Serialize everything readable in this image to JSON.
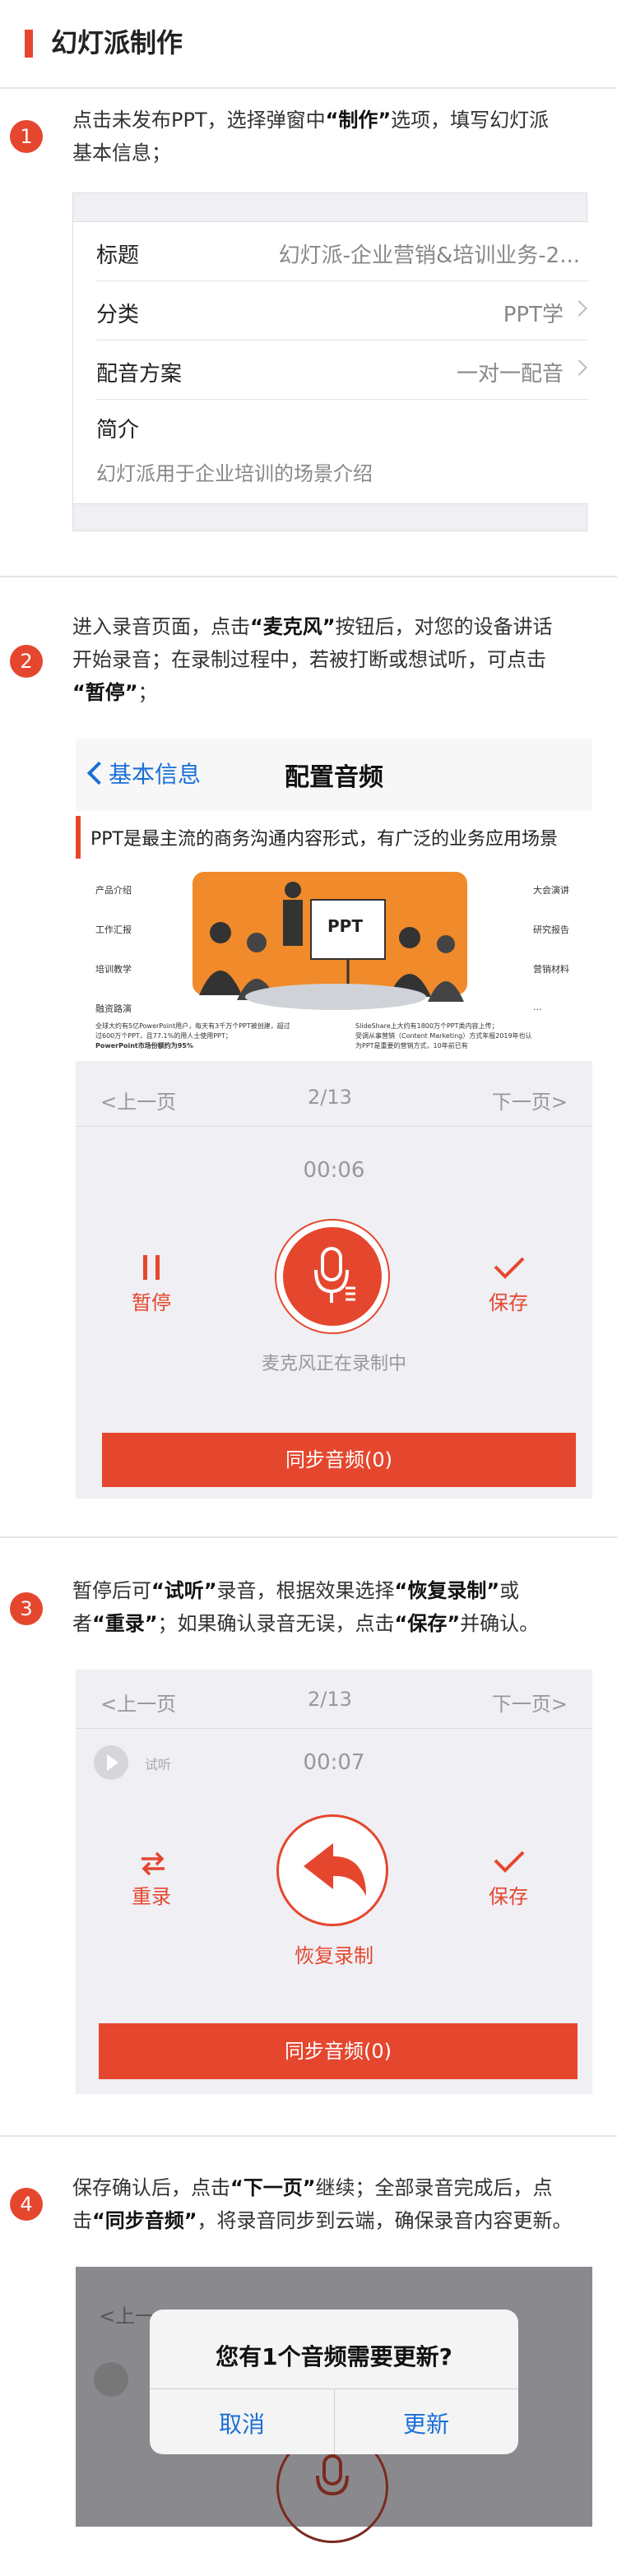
{
  "header": {
    "title": "幻灯派制作"
  },
  "steps": [
    {
      "num": "1",
      "text_a": "点击未发布PPT，选择弹窗中",
      "text_b": "“制作”",
      "text_c": "选项，填写幻灯派",
      "text_d": "基本信息；"
    },
    {
      "num": "2",
      "line1_a": "进入录音页面，点击",
      "line1_b": "“麦克风”",
      "line1_c": "按钮后，对您的设备讲话",
      "line2": "开始录音；在录制过程中，若被打断或想试听，可点击",
      "line3": "“暂停”",
      "line3_c": "；"
    },
    {
      "num": "3",
      "line1_a": "暂停后可",
      "line1_b": "“试听”",
      "line1_c": "录音，根据效果选择",
      "line1_d": "“恢复录制”",
      "line1_e": "或",
      "line2_a": "者",
      "line2_b": "“重录”",
      "line2_c": "；如果确认录音无误，点击",
      "line2_d": "“保存”",
      "line2_e": "并确认。"
    },
    {
      "num": "4",
      "line1_a": "保存确认后，点击",
      "line1_b": "“下一页”",
      "line1_c": "继续；全部录音完成后，点",
      "line2_a": "击",
      "line2_b": "“同步音频”",
      "line2_c": "，将录音同步到云端，确保录音内容更新。"
    }
  ],
  "form": {
    "rows": [
      {
        "key": "标题",
        "value": "幻灯派-企业营销&培训业务-2..."
      },
      {
        "key": "分类",
        "value": "PPT学"
      },
      {
        "key": "配音方案",
        "value": "一对一配音"
      }
    ],
    "intro_key": "简介",
    "intro_value": "幻灯派用于企业培训的场景介绍"
  },
  "screen2": {
    "back_label": "基本信息",
    "title": "配置音频",
    "slide_caption": "PPT是最主流的商务沟通内容形式，有广泛的业务应用场景",
    "slide_left_labels": [
      "产品介绍",
      "工作汇报",
      "培训教学",
      "融资路演"
    ],
    "slide_right_labels": [
      "大会演讲",
      "研究报告",
      "营销材料",
      "..."
    ],
    "slide_ppt_label": "PPT",
    "slide_note_left_1": "全球大约有5亿PowerPoint用户，每天有3千万个PPT被创建，超过",
    "slide_note_left_2": "过600万个PPT，且77.1%的用人士使用PPT；",
    "slide_note_left_3": "PowerPoint市场份额约为95%",
    "slide_note_right_1": "SlideShare上大约有1800万个PPT类内容上传；",
    "slide_note_right_2": "受调从事营销（Content Marketing）方式年报2019年也认",
    "slide_note_right_3": "为PPT是重要的营销方式，10年前已有",
    "prev": "<上一页",
    "page": "2/13",
    "next": "下一页>",
    "timer": "00:06",
    "pause_label": "暂停",
    "save_label": "保存",
    "status": "麦克风正在录制中",
    "sync_label": "同步音频(0)"
  },
  "screen3": {
    "prev": "<上一页",
    "page": "2/13",
    "next": "下一页>",
    "listen_label": "试听",
    "timer": "00:07",
    "rerecord_label": "重录",
    "save_label": "保存",
    "resume_label": "恢复录制",
    "sync_label": "同步音频(0)"
  },
  "screen4": {
    "prev_partial": "<上一",
    "dialog_title": "您有1个音频需要更新?",
    "cancel_label": "取消",
    "update_label": "更新"
  },
  "colors": {
    "accent": "#e5472e",
    "link": "#1a6fd6"
  }
}
